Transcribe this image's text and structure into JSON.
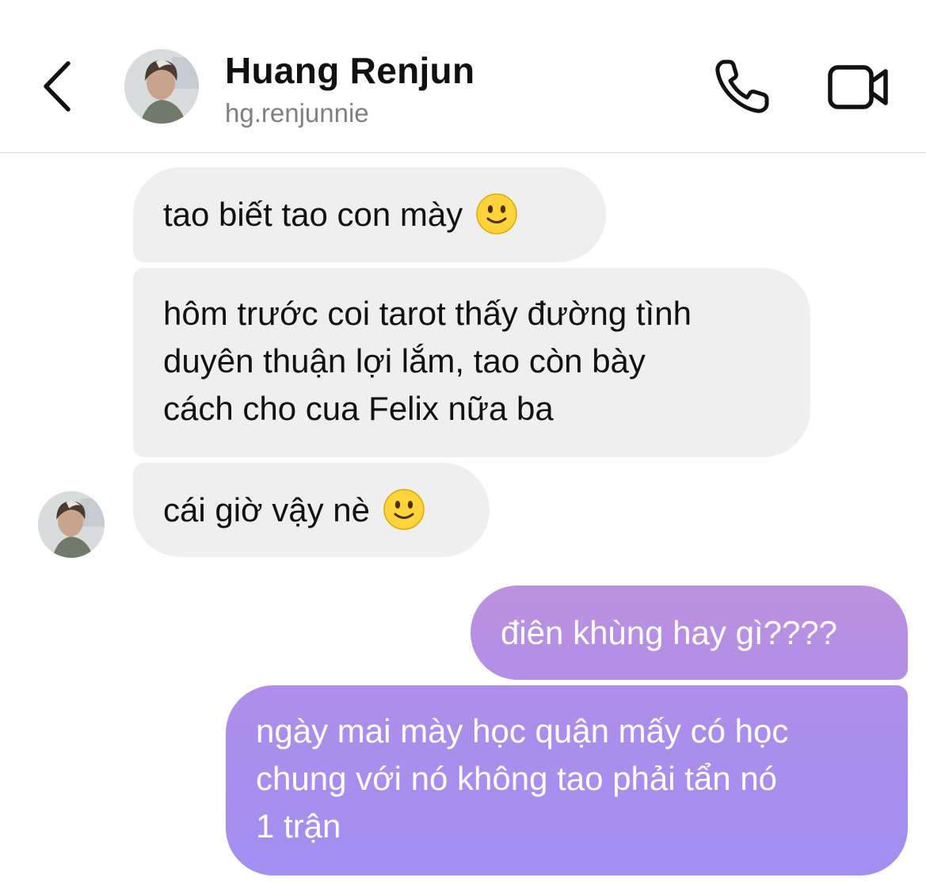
{
  "header": {
    "title": "Huang Renjun",
    "username": "hg.renjunnie",
    "back_icon": "chevron-left-icon",
    "call_icon": "phone-icon",
    "video_icon": "video-camera-icon"
  },
  "messages": [
    {
      "sender": "them",
      "text": "tao biết tao con mày",
      "emoji": "slightly-smiling-face"
    },
    {
      "sender": "them",
      "lines": [
        "hôm trước coi tarot thấy đường tình",
        "duyên thuận lợi lắm, tao còn bày",
        "cách cho cua Felix nữa ba"
      ]
    },
    {
      "sender": "them",
      "text": "cái giờ vậy nè",
      "emoji": "slightly-smiling-face"
    },
    {
      "sender": "me",
      "text": "điên khùng hay gì????"
    },
    {
      "sender": "me",
      "lines": [
        "ngày mai mày học quận mấy có học",
        "chung với nó không tao phải tẩn nó",
        "1 trận"
      ]
    }
  ],
  "colors": {
    "incoming_bubble": "#efefef",
    "outgoing_top": "#b98fe0",
    "outgoing_bottom": "#a48ef0",
    "username_gray": "#808080"
  }
}
